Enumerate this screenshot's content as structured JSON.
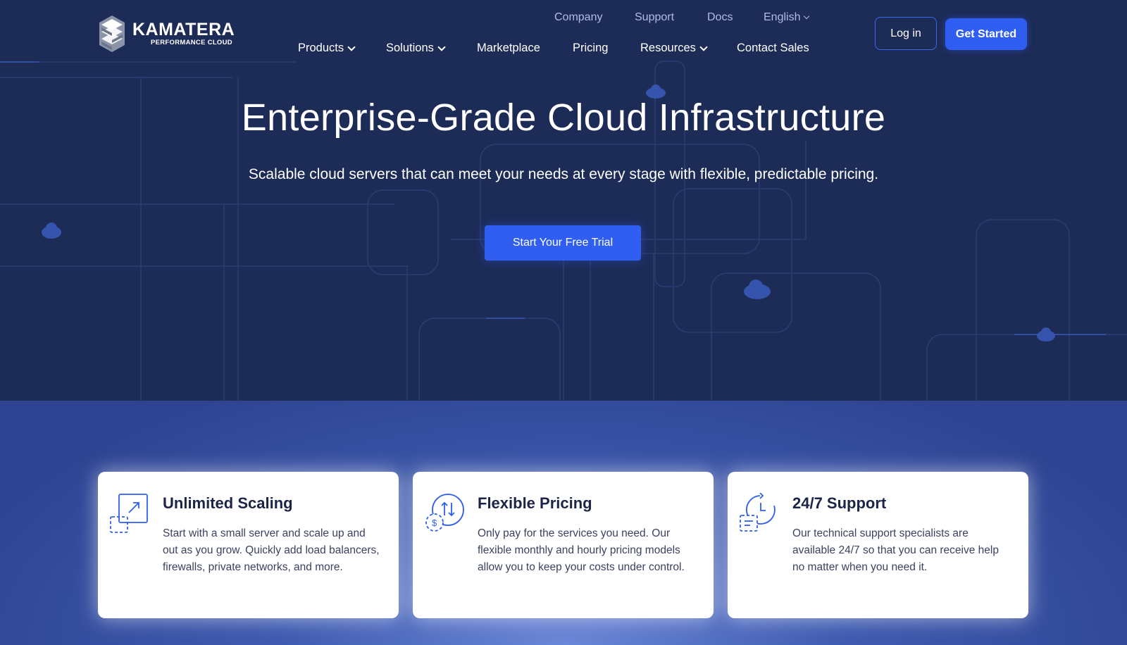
{
  "brand": {
    "name": "KAMATERA",
    "tagline": "PERFORMANCE CLOUD"
  },
  "top_nav": {
    "company": "Company",
    "support": "Support",
    "docs": "Docs",
    "language": "English"
  },
  "main_nav": {
    "products": "Products",
    "solutions": "Solutions",
    "marketplace": "Marketplace",
    "pricing": "Pricing",
    "resources": "Resources",
    "contact_sales": "Contact Sales"
  },
  "header_actions": {
    "login": "Log in",
    "get_started": "Get Started"
  },
  "hero": {
    "title": "Enterprise-Grade Cloud Infrastructure",
    "subtitle": "Scalable cloud servers that can meet your needs at every stage with flexible, predictable pricing.",
    "cta": "Start Your Free Trial"
  },
  "features": [
    {
      "icon": "scaling-icon",
      "title": "Unlimited Scaling",
      "text": "Start with a small server and scale up and out as you grow. Quickly add load balancers, firewalls, private networks, and more."
    },
    {
      "icon": "pricing-icon",
      "title": "Flexible Pricing",
      "text": "Only pay for the services you need. Our flexible monthly and hourly pricing models allow you to keep your costs under control."
    },
    {
      "icon": "support-icon",
      "title": "24/7 Support",
      "text": "Our technical support specialists are available 24/7 so that you can receive help no matter when you need it."
    }
  ],
  "colors": {
    "hero_bg": "#1d2b57",
    "accent": "#2f5ef0",
    "card_bg": "#ffffff",
    "text_dark": "#1c2448"
  }
}
